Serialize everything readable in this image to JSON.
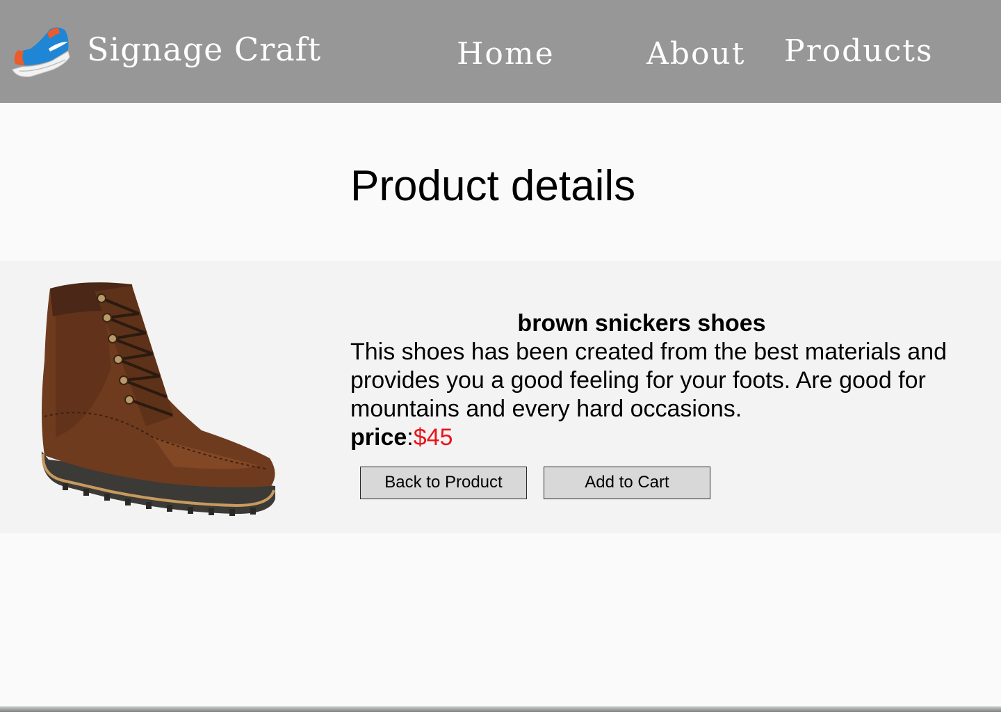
{
  "header": {
    "brand_name": "Signage Craft",
    "logo_icon": "running-shoe-icon",
    "nav": {
      "home": "Home",
      "about": "About",
      "products": "Products"
    }
  },
  "main": {
    "title": "Product details",
    "product": {
      "image_icon": "brown-boot-image",
      "name": "brown snickers shoes",
      "description": "This shoes has been created from the best materials and provides you a good feeling for your foots. Are good for mountains and every hard occasions.",
      "price_label": "price",
      "price_separator": ":",
      "price_value": "$45",
      "price_color": "#e8141a"
    },
    "buttons": {
      "back": "Back to Product",
      "add_to_cart": "Add to Cart"
    }
  },
  "colors": {
    "header_bg": "#979797",
    "panel_bg": "#f3f3f3",
    "page_bg": "#fafafa",
    "button_bg": "#d8d8d8"
  }
}
